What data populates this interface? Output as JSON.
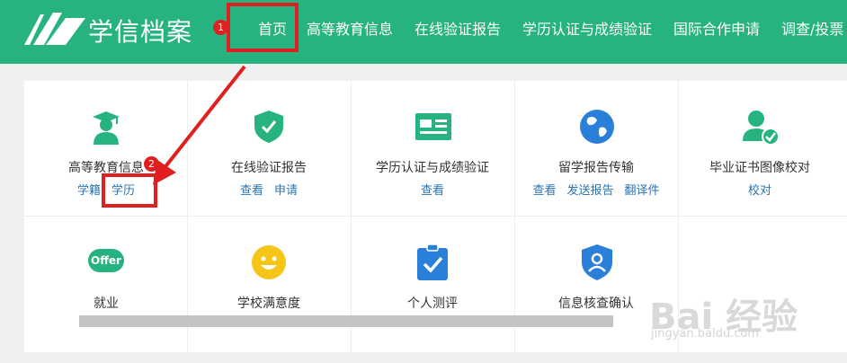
{
  "header": {
    "brand": "学信档案",
    "nav": [
      "首页",
      "高等教育信息",
      "在线验证报告",
      "学历认证与成绩验证",
      "国际合作申请",
      "调查/投票"
    ]
  },
  "annotations": {
    "step1": "1",
    "step2": "2"
  },
  "services": [
    {
      "title": "高等教育信息",
      "links": [
        "学籍",
        "学历"
      ]
    },
    {
      "title": "在线验证报告",
      "links": [
        "查看",
        "申请"
      ]
    },
    {
      "title": "学历认证与成绩验证",
      "links": [
        "查看"
      ]
    },
    {
      "title": "留学报告传输",
      "links": [
        "查看",
        "发送报告",
        "翻译件"
      ]
    },
    {
      "title": "毕业证书图像校对",
      "links": [
        "校对"
      ]
    },
    {
      "title": "就业",
      "links": [],
      "icon_text": "Offer"
    },
    {
      "title": "学校满意度",
      "links": []
    },
    {
      "title": "个人测评",
      "links": []
    },
    {
      "title": "信息核查确认",
      "links": []
    }
  ],
  "watermark": {
    "text": "Bai 经验",
    "url": "jingyan.baidu.com"
  },
  "colors": {
    "header": "#27b37f",
    "link": "#2a74b3",
    "highlight": "#e02020"
  }
}
